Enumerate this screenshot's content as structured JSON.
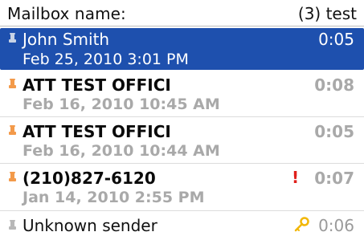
{
  "header": {
    "title": "Mailbox name:",
    "mailbox": "(3) test"
  },
  "messages": [
    {
      "sender": "John Smith",
      "date": "Feb 25, 2010 3:01 PM",
      "duration": "0:05",
      "state": "selected",
      "icon": "voicemail-read-icon"
    },
    {
      "sender": "ATT TEST OFFICI",
      "date": "Feb 16, 2010 10:45 AM",
      "duration": "0:08",
      "state": "unread",
      "icon": "voicemail-unread-icon"
    },
    {
      "sender": "ATT TEST OFFICI",
      "date": "Feb 16, 2010 10:44 AM",
      "duration": "0:05",
      "state": "unread",
      "icon": "voicemail-unread-icon"
    },
    {
      "sender": "(210)827-6120",
      "date": "Jan 14, 2010 2:55 PM",
      "duration": "0:07",
      "state": "unread",
      "icon": "voicemail-unread-icon",
      "flag": "!",
      "flag_icon": "urgent-priority-icon"
    },
    {
      "sender": "Unknown sender",
      "duration": "0:06",
      "state": "read",
      "icon": "voicemail-read-icon",
      "flag_icon": "key-icon"
    }
  ],
  "colors": {
    "selection": "#1e50ae",
    "unread_icon": "#f39a4a",
    "read_icon": "#b8b8b8",
    "priority": "#e0201b",
    "key": "#f2b705"
  }
}
